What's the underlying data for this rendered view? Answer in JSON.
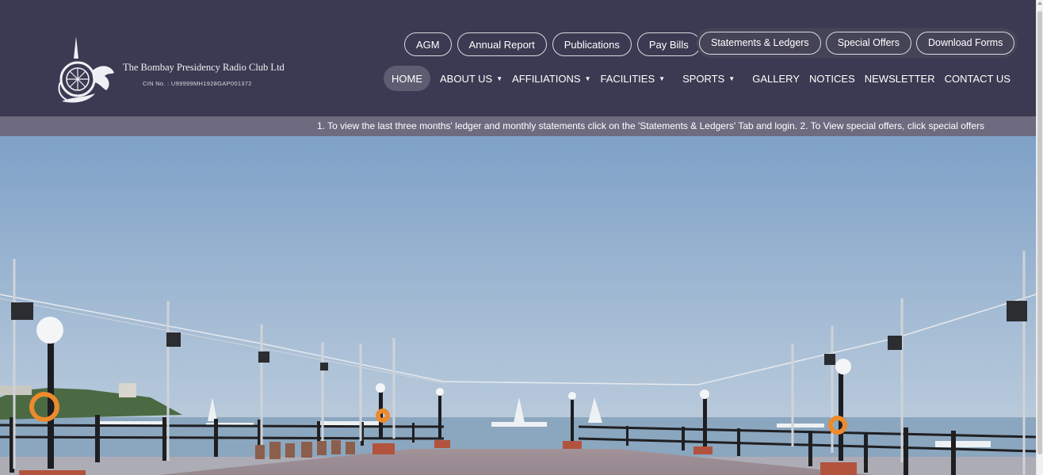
{
  "brand": {
    "name": "The Bombay Presidency Radio Club Ltd",
    "cin": "CIN No. : U99999MH1928GAP001372"
  },
  "top_links": [
    "AGM",
    "Annual Report",
    "Publications",
    "Pay Bills"
  ],
  "top_links_group": [
    "Statements & Ledgers",
    "Special Offers",
    "Download Forms"
  ],
  "nav": [
    {
      "label": "HOME",
      "active": true
    },
    {
      "label": "ABOUT US",
      "dropdown": true
    },
    {
      "label": "AFFILIATIONS",
      "dropdown": true
    },
    {
      "label": "FACILITIES",
      "dropdown": true
    },
    {
      "label": "SPORTS",
      "dropdown": true
    },
    {
      "label": "GALLERY"
    },
    {
      "label": "NOTICES"
    },
    {
      "label": "NEWSLETTER"
    },
    {
      "label": "CONTACT US"
    }
  ],
  "ticker": {
    "text": "1. To view the last three months' ledger and monthly statements click on the 'Statements & Ledgers' Tab and login. 2. To View special offers, click special offers"
  },
  "hero": {
    "subject": "pier-photo"
  },
  "colors": {
    "header_bg": "#3b3a52",
    "ticker_bg": "#6e6b80",
    "sky_top": "#7ea1c7",
    "sea": "#8ba6bf"
  }
}
